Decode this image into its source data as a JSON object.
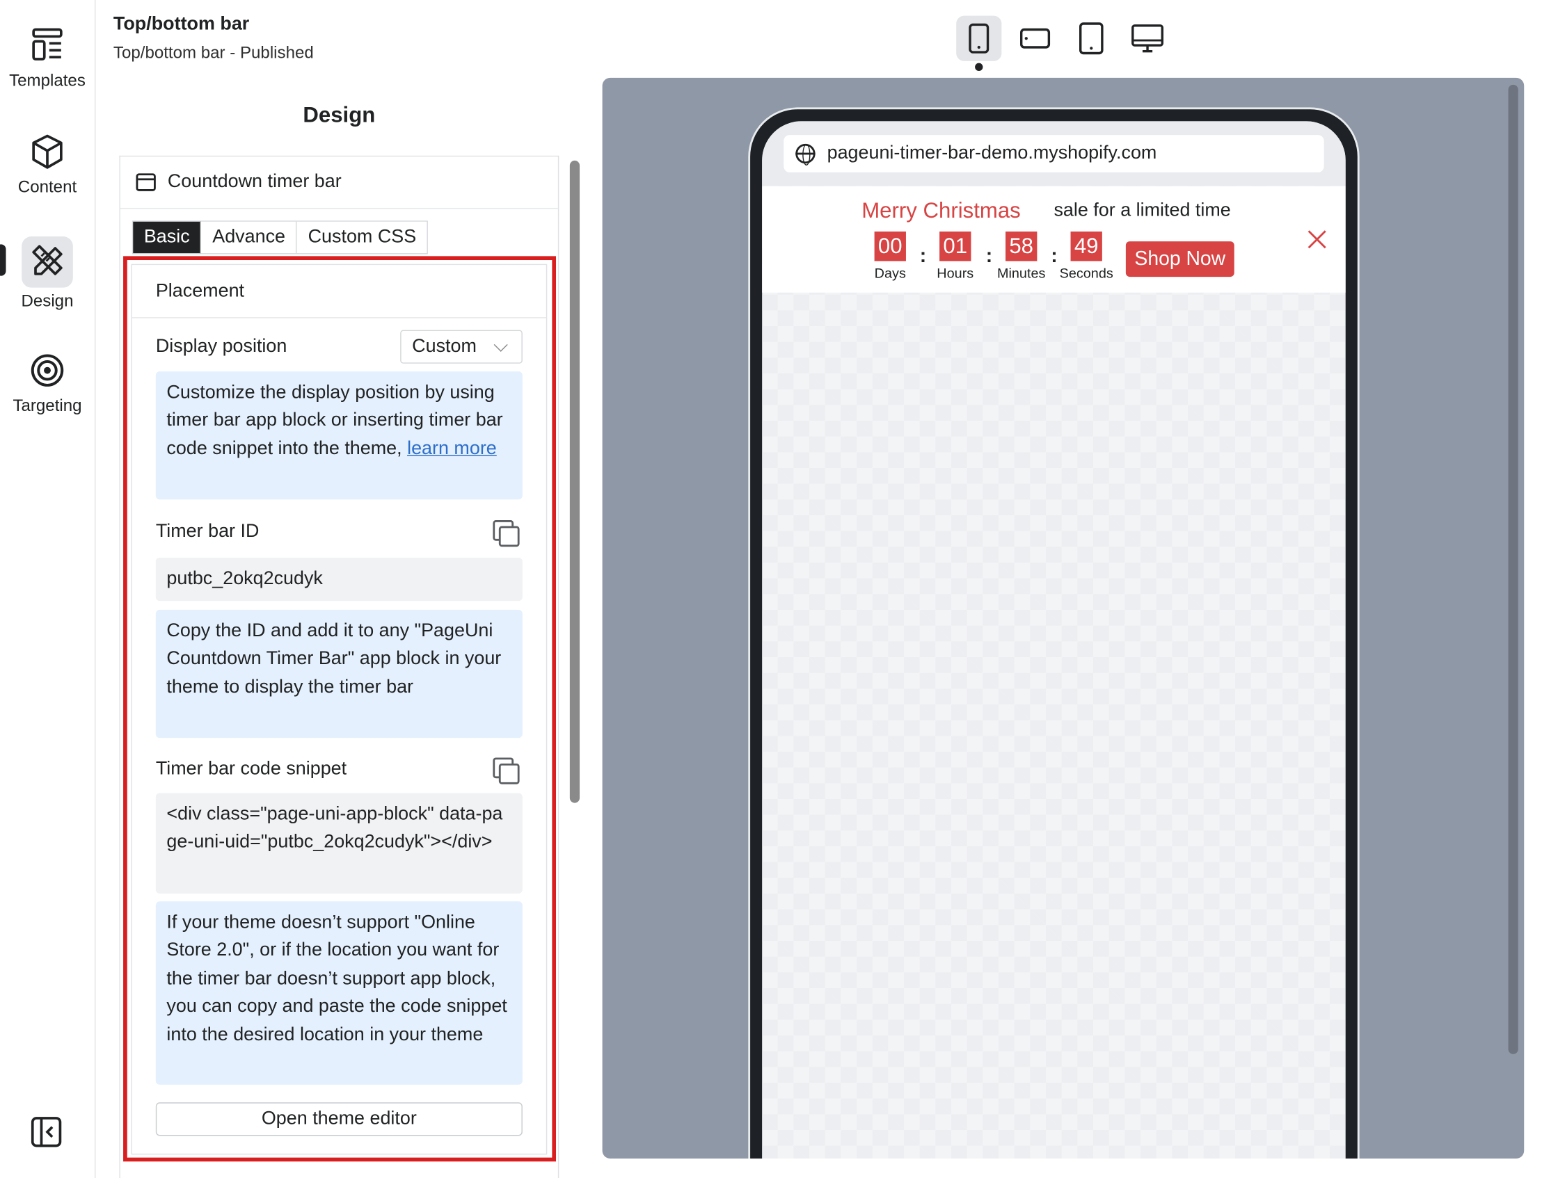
{
  "nav": {
    "items": [
      {
        "label": "Templates",
        "icon": "templates-icon"
      },
      {
        "label": "Content",
        "icon": "cube-icon"
      },
      {
        "label": "Design",
        "icon": "design-pencil-ruler-icon",
        "active": true
      },
      {
        "label": "Targeting",
        "icon": "target-icon"
      }
    ],
    "collapse_icon": "collapse-sidebar-icon"
  },
  "header": {
    "title": "Top/bottom bar",
    "subtitle": "Top/bottom bar - Published"
  },
  "design": {
    "title": "Design",
    "section_title": "Countdown timer bar",
    "tabs": [
      {
        "label": "Basic",
        "active": true
      },
      {
        "label": "Advance",
        "active": false
      },
      {
        "label": "Custom CSS",
        "active": false
      }
    ],
    "placement": {
      "title": "Placement",
      "display_position_label": "Display position",
      "display_position_value": "Custom",
      "custom_note": "Customize the display position by using timer bar app block or inserting timer bar code snippet into the theme,",
      "learn_more": "learn more",
      "timer_bar_id_label": "Timer bar ID",
      "timer_bar_id_value": "putbc_2okq2cudyk",
      "id_note": "Copy the ID and add it to any \"PageUni Countdown Timer Bar\" app block in your theme to display the timer bar",
      "code_snippet_label": "Timer bar code snippet",
      "code_snippet_value": "<div class=\"page-uni-app-block\" data-page-uni-uid=\"putbc_2okq2cudyk\"></div>",
      "snippet_note": "If your theme doesn’t support \"Online Store 2.0\", or if the location you want for the timer bar doesn’t support app block, you can copy and paste the code snippet into the desired location in your theme",
      "open_theme_editor": "Open theme editor"
    }
  },
  "preview": {
    "devices": [
      "mobile-icon",
      "mobile-landscape-icon",
      "tablet-icon",
      "desktop-icon"
    ],
    "active_device": "mobile-icon",
    "url": "pageuni-timer-bar-demo.myshopify.com",
    "timer_bar": {
      "headline": "Merry Christmas",
      "message": "sale for a limited time",
      "units": [
        {
          "value": "00",
          "label": "Days"
        },
        {
          "value": "01",
          "label": "Hours"
        },
        {
          "value": "58",
          "label": "Minutes"
        },
        {
          "value": "49",
          "label": "Seconds"
        }
      ],
      "button": "Shop Now",
      "accent_color": "#d84343"
    }
  },
  "colors": {
    "highlight_border": "#d81e1e",
    "note_background": "#e4f0fd",
    "stage_background": "#8f98a6"
  }
}
